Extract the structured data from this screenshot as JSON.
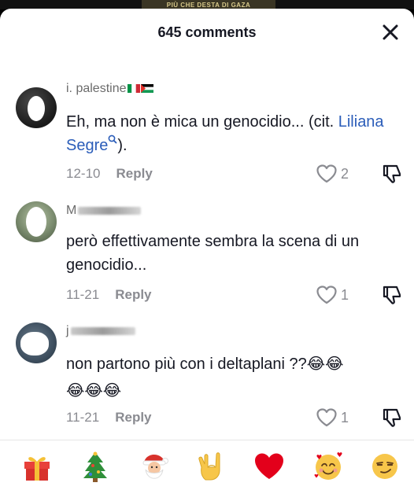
{
  "top_banner": {
    "text": "PIÙ CHE DESTA DI GAZA"
  },
  "header": {
    "title": "645 comments",
    "close_icon": "close-icon"
  },
  "comments": [
    {
      "username": "i.  palestine",
      "text": "Eh, ma non è mica un genocidio... (cit. ",
      "link_text": "Liliana Segre",
      "text_after": ").",
      "date": "12-10",
      "reply_label": "Reply",
      "likes": "2"
    },
    {
      "username": "M",
      "text": "però effettivamente sembra la scena di un genocidio...",
      "date": "11-21",
      "reply_label": "Reply",
      "likes": "1"
    },
    {
      "username": "j",
      "text": "non partono più con i deltaplani ??😂😂",
      "text_line2": "😂😂😂",
      "date": "11-21",
      "reply_label": "Reply",
      "likes": "1"
    }
  ],
  "emoji_bar": [
    "gift",
    "christmas-tree",
    "santa",
    "love-you-gesture",
    "red-heart",
    "smiling-face-with-hearts",
    "smirking-face"
  ],
  "colors": {
    "link": "#2b5db9",
    "heart_red": "#e3001b",
    "meta_gray": "#8a8b91"
  }
}
